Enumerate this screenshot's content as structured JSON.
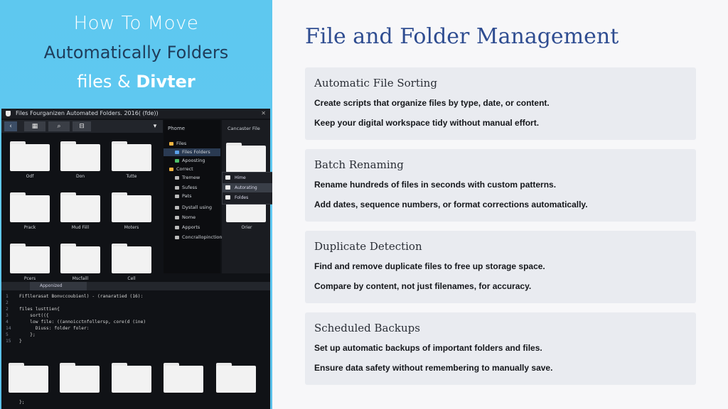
{
  "hero": {
    "line1": "How To Move",
    "line2": "Automatically Folders",
    "line3_plain": "files & ",
    "line3_bold": "Divter"
  },
  "window": {
    "title": "Files Fourganizen Automated Folders. 2016( (fde))",
    "close": "✕",
    "toolbar": {
      "back": "‹",
      "grid": "▦",
      "search": "⌕",
      "view": "⊟",
      "dropdown": "▾"
    },
    "folders": [
      {
        "label": "Odf"
      },
      {
        "label": "Don"
      },
      {
        "label": "Tutte"
      },
      {
        "label": "Prack"
      },
      {
        "label": "Mud Fiill"
      },
      {
        "label": "Moters"
      },
      {
        "label": "Pcers"
      },
      {
        "label": "Mscfaill"
      },
      {
        "label": "Cell"
      }
    ],
    "sidebar": {
      "header": "Phome",
      "items": [
        {
          "label": "Files",
          "icon": "folder-icon",
          "color": "#f2b441"
        },
        {
          "label": "Files Folders",
          "icon": "folder-icon",
          "color": "#5aa0e8"
        },
        {
          "label": "Apoosting",
          "icon": "app-icon",
          "color": "#4fbf6a"
        },
        {
          "label": "Correct",
          "icon": "folder-icon",
          "color": "#f2b441"
        },
        {
          "label": "Tremew",
          "icon": "folder-icon",
          "color": "#bbbbbb"
        },
        {
          "label": "Sufess",
          "icon": "folder-icon",
          "color": "#bbbbbb"
        },
        {
          "label": "Pats",
          "icon": "file-icon",
          "color": "#bbbbbb"
        },
        {
          "label": "Dystall using",
          "icon": "drive-icon",
          "color": "#bbbbbb"
        },
        {
          "label": "Nome",
          "icon": "file-icon",
          "color": "#bbbbbb"
        },
        {
          "label": "Apports",
          "icon": "gear-icon",
          "color": "#bbbbbb"
        },
        {
          "label": "Concrallopinctions",
          "icon": "drive-icon",
          "color": "#bbbbbb"
        }
      ]
    },
    "right_pane": {
      "header": "Cancaster File",
      "folder_label": "Orier"
    },
    "context_menu": [
      {
        "label": "Hime"
      },
      {
        "label": "Autorating"
      },
      {
        "label": "Foldes"
      }
    ],
    "tab_label": "Apponized",
    "code_lines": [
      {
        "n": "1",
        "text": "Fifllerasat Bonvccoubienl) - (ranaratied (16):"
      },
      {
        "n": "2",
        "text": ""
      },
      {
        "n": "2",
        "text": "files lusttien{"
      },
      {
        "n": "3",
        "text": "    sort(({"
      },
      {
        "n": "4",
        "text": "    low file: ((annoicctnfollersp, core(d (ine)"
      },
      {
        "n": "14",
        "text": "      Diuss: folder foler:"
      },
      {
        "n": "5",
        "text": "    };"
      },
      {
        "n": "15",
        "text": "}"
      }
    ],
    "bottom_text": "};"
  },
  "main": {
    "title": "File and Folder Management",
    "cards": [
      {
        "heading": "Automatic File Sorting",
        "line1": "Create scripts that organize files by type, date, or content.",
        "line2": "Keep your digital workspace tidy without manual effort."
      },
      {
        "heading": "Batch Renaming",
        "line1": "Rename hundreds of files in seconds with custom patterns.",
        "line2": "Add dates, sequence numbers, or format corrections automatically."
      },
      {
        "heading": "Duplicate Detection",
        "line1": "Find and remove duplicate files to free up storage space.",
        "line2": "Compare by content, not just filenames, for accuracy."
      },
      {
        "heading": "Scheduled Backups",
        "line1": "Set up automatic backups of important folders and files.",
        "line2": "Ensure data safety without remembering to manually save."
      }
    ]
  },
  "colors": {
    "accent": "#2f4d91",
    "card_bg": "#e9ebf0",
    "hero_bg": "#5ec8ef"
  }
}
